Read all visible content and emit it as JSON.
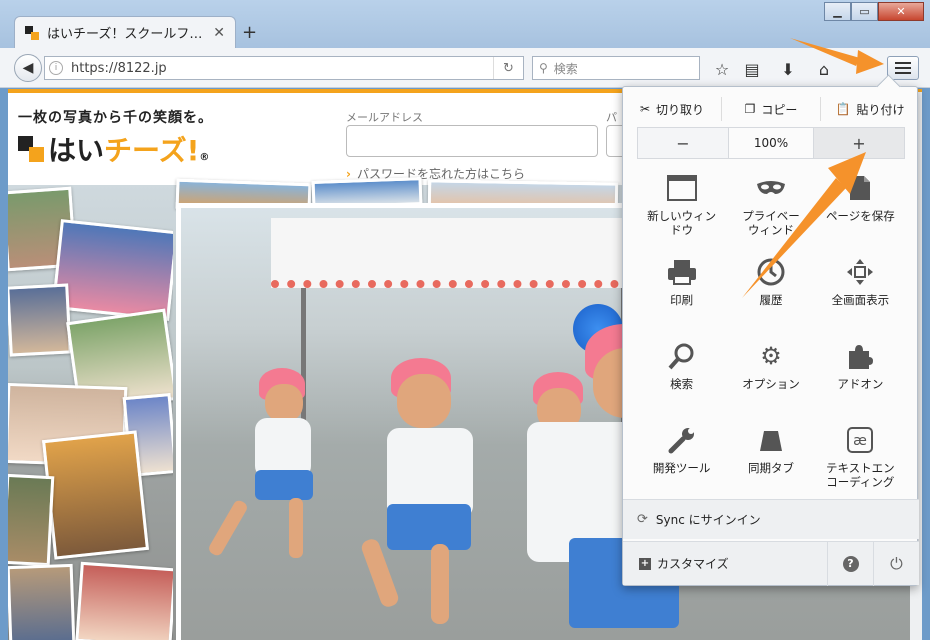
{
  "window": {
    "min_label": "▁",
    "max_label": "▭",
    "close_label": "✕"
  },
  "tab": {
    "title": "はいチーズ！スクールフ…",
    "close_label": "✕",
    "new_tab_label": "+"
  },
  "navbar": {
    "url": "https://8122.jp",
    "search_placeholder": "検索"
  },
  "page": {
    "tagline": "一枚の写真から千の笑顔を。",
    "logo_text_1": "はい",
    "logo_text_2": "チーズ!",
    "logo_mark": "®",
    "email_label": "メールアドレス",
    "password_label": "パ",
    "forgot_label": "パスワードを忘れた方はこちら"
  },
  "menu": {
    "edit": [
      {
        "label": "切り取り",
        "icon": "scissors-icon"
      },
      {
        "label": "コピー",
        "icon": "copy-icon"
      },
      {
        "label": "貼り付け",
        "icon": "paste-icon"
      }
    ],
    "zoom": {
      "minus": "−",
      "value": "100%",
      "plus": "+"
    },
    "items": [
      {
        "label": "新しいウィン\nドウ",
        "icon": "new-window-icon"
      },
      {
        "label": "プライベー\nウィンド",
        "icon": "private-mask-icon"
      },
      {
        "label": "ページを保存",
        "icon": "save-page-icon"
      },
      {
        "label": "印刷",
        "icon": "print-icon"
      },
      {
        "label": "履歴",
        "icon": "history-icon"
      },
      {
        "label": "全画面表示",
        "icon": "fullscreen-icon"
      },
      {
        "label": "検索",
        "icon": "search-icon"
      },
      {
        "label": "オプション",
        "icon": "gear-icon"
      },
      {
        "label": "アドオン",
        "icon": "puzzle-icon"
      },
      {
        "label": "開発ツール",
        "icon": "wrench-icon"
      },
      {
        "label": "同期タブ",
        "icon": "synced-tabs-icon"
      },
      {
        "label": "テキストエン\nコーディング",
        "icon": "encoding-icon"
      }
    ],
    "sync_label": "Sync にサインイン",
    "customize_label": "カスタマイズ",
    "help_label": "?",
    "power_label": "⏻"
  },
  "colors": {
    "accent": "#f4a31c",
    "annotation_arrow": "#f5922b"
  }
}
